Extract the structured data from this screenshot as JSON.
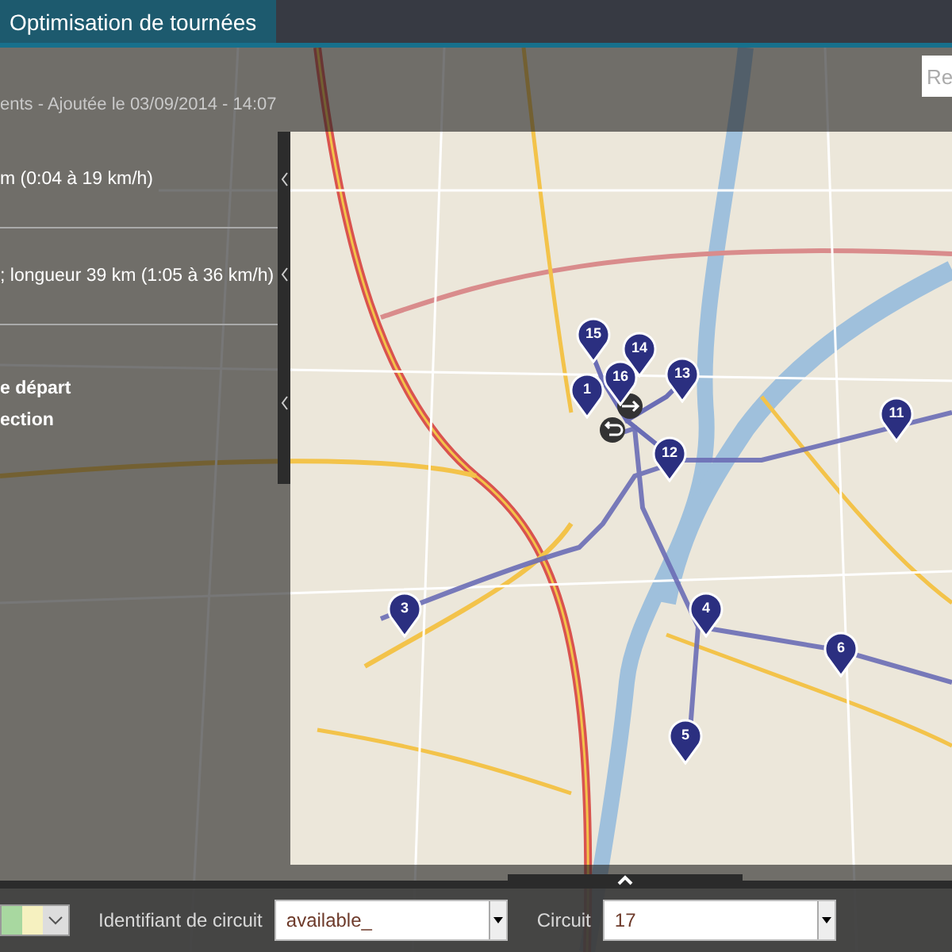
{
  "window": {
    "title": "Optimisation de tournées"
  },
  "search": {
    "placeholder": "Re"
  },
  "subtitle": "ents - Ajoutée le 03/09/2014 - 14:07",
  "panel": {
    "sections": [
      {
        "expanded": true,
        "lines": [
          {
            "kind": "info",
            "text": "m (0:04 à 19 km/h)"
          }
        ]
      },
      {
        "expanded": true,
        "lines": [
          {
            "kind": "info",
            "text": "; longueur 39 km (1:05 à 36 km/h)"
          }
        ]
      },
      {
        "expanded": true,
        "lines": [
          {
            "kind": "action",
            "text": "e départ"
          },
          {
            "kind": "action",
            "text": "ection"
          }
        ]
      }
    ]
  },
  "markers": [
    {
      "label": "15"
    },
    {
      "label": "14"
    },
    {
      "label": "16"
    },
    {
      "label": "13"
    },
    {
      "label": "1"
    },
    {
      "label": "11"
    },
    {
      "label": "12"
    },
    {
      "label": "3"
    },
    {
      "label": "4"
    },
    {
      "label": "6"
    },
    {
      "label": "5"
    }
  ],
  "filters": {
    "circuit_id": {
      "label": "Identifiant de circuit",
      "value": "available_"
    },
    "circuit": {
      "label": "Circuit",
      "value": "17"
    }
  }
}
